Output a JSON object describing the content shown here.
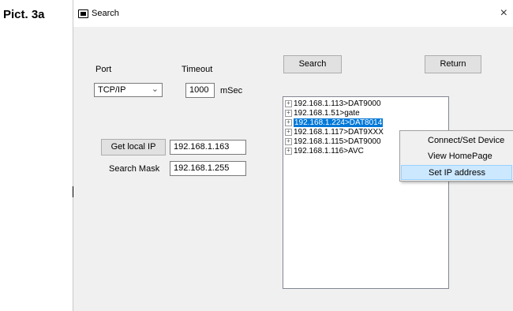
{
  "figure_label": "Pict. 3a",
  "window": {
    "title": "Search",
    "close_symbol": "×"
  },
  "port": {
    "label": "Port",
    "selected": "TCP/IP"
  },
  "timeout": {
    "label": "Timeout",
    "value": "1000",
    "unit": "mSec"
  },
  "get_local_ip": {
    "button_label": "Get local IP",
    "value": "192.168.1.163"
  },
  "search_mask": {
    "label": "Search Mask",
    "value": "192.168.1.255"
  },
  "buttons": {
    "search": "Search",
    "return": "Return"
  },
  "devices": [
    "192.168.1.113>DAT9000",
    "192.168.1.51>gate",
    "192.168.1.224>DAT8014",
    "192.168.1.117>DAT9XXX",
    "192.168.1.115>DAT9000",
    "192.168.1.116>AVC"
  ],
  "selected_device_index": 2,
  "context_menu": [
    "Connect/Set Device",
    "View HomePage",
    "Set IP address"
  ],
  "context_menu_highlighted_index": 2
}
